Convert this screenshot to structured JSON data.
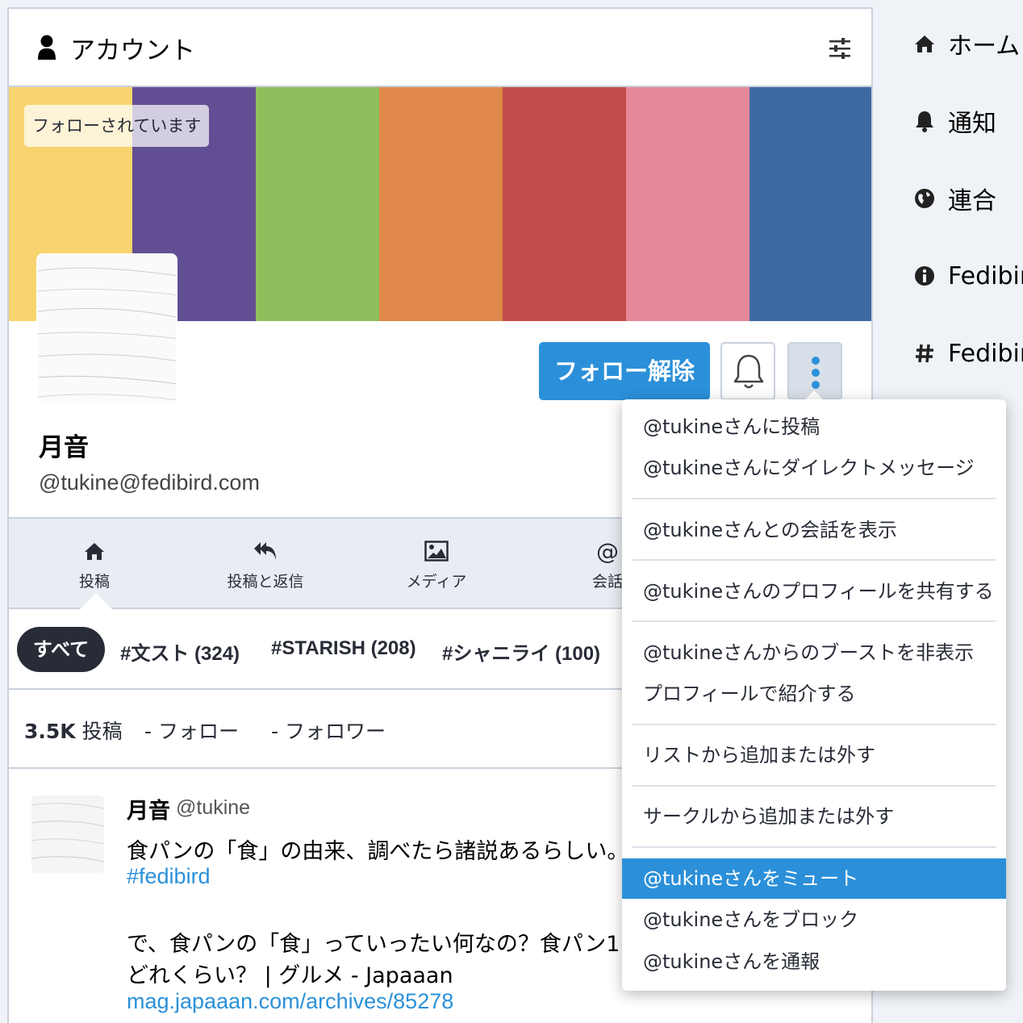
{
  "column": {
    "title": "アカウント",
    "followed_badge": "フォローされています",
    "banner_colors": [
      "#f7d46e",
      "#614e93",
      "#8fbf5c",
      "#df884a",
      "#c04d49",
      "#e5889a",
      "#3f6aa1"
    ],
    "actions": {
      "unfollow": "フォロー解除"
    },
    "profile": {
      "display_name": "月音",
      "acct": "@tukine@fedibird.com"
    },
    "tabs": [
      {
        "label": "投稿",
        "icon": "home-icon"
      },
      {
        "label": "投稿と返信",
        "icon": "reply-all-icon"
      },
      {
        "label": "メディア",
        "icon": "picture-icon"
      },
      {
        "label": "会話",
        "icon": "at-icon"
      }
    ],
    "tags": {
      "all": "すべて",
      "items": [
        "#文スト (324)",
        "#STARISH (208)",
        "#シャニライ (100)"
      ]
    },
    "counts": {
      "posts_value": "3.5K",
      "posts_label": "投稿",
      "following": "- フォロー",
      "followers": "- フォロワー"
    },
    "status": {
      "display_name": "月音",
      "acct": "@tukine",
      "line1": "食パンの「食」の由来、調べたら諸説あるらしい。",
      "hashtag": "#fedibird",
      "line2": "で、食パンの「食」っていったい何なの？食パン1",
      "line3": "どれくらい？ | グルメ - Japaaan",
      "link": "mag.japaaan.com/archives/85278"
    }
  },
  "nav": {
    "items": [
      {
        "label": "ホーム",
        "icon": "home-icon"
      },
      {
        "label": "通知",
        "icon": "bell-icon"
      },
      {
        "label": "連合",
        "icon": "globe-icon"
      },
      {
        "label": "Fedibird",
        "icon": "info-icon"
      },
      {
        "label": "Fedibird",
        "icon": "hash-icon"
      }
    ]
  },
  "menu": {
    "items": [
      "@tukineさんに投稿",
      "@tukineさんにダイレクトメッセージ",
      "@tukineさんとの会話を表示",
      "@tukineさんのプロフィールを共有する",
      "@tukineさんからのブーストを非表示",
      "プロフィールで紹介する",
      "リストから追加または外す",
      "サークルから追加または外す",
      "@tukineさんをミュート",
      "@tukineさんをブロック",
      "@tukineさんを通報"
    ],
    "highlighted": "@tukineさんをミュート"
  },
  "colors": {
    "accent": "#2b90d9",
    "dark": "#282c37",
    "border": "#c9d1dc"
  }
}
